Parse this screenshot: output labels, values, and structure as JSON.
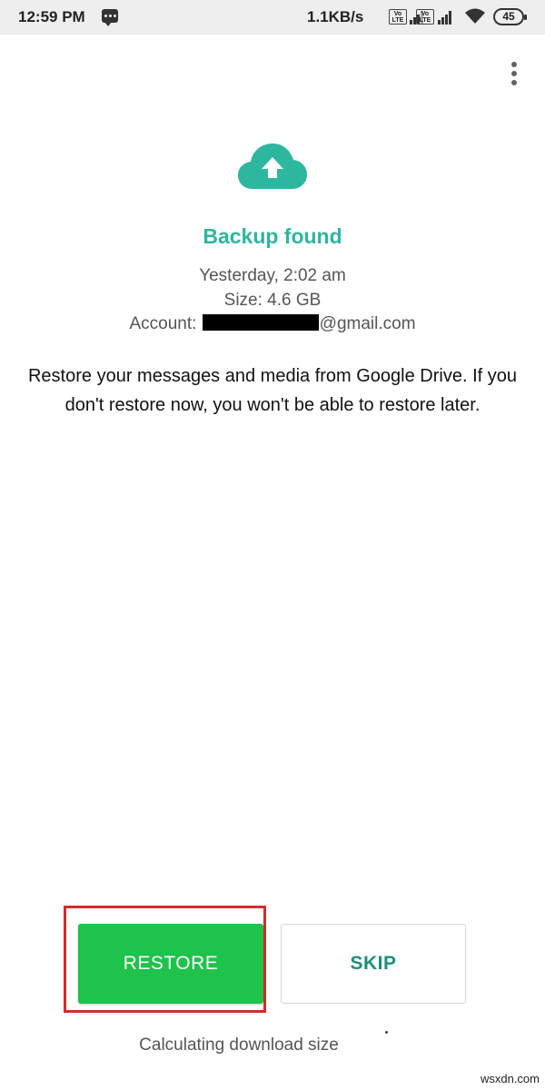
{
  "status_bar": {
    "time": "12:59 PM",
    "speed": "1.1KB/s",
    "volte_label": "Vo LTE",
    "battery": "45",
    "icons": [
      "chat-notification-icon",
      "volte-icon",
      "signal-icon",
      "volte-icon",
      "signal-icon",
      "wifi-icon",
      "battery-icon"
    ]
  },
  "header": {
    "menu_icon": "more-vert-icon"
  },
  "backup": {
    "icon": "cloud-upload-icon",
    "accent_color": "#2db79f",
    "title": "Backup found",
    "date": "Yesterday, 2:02 am",
    "size": "Size: 4.6 GB",
    "account_label": "Account:",
    "account_domain": "@gmail.com"
  },
  "description": "Restore your messages and media from Google Drive. If you don't restore now, you won't be able to restore later.",
  "actions": {
    "restore_label": "RESTORE",
    "restore_color": "#1fc24a",
    "skip_label": "SKIP"
  },
  "progress": {
    "status_text": "Calculating download size"
  },
  "watermark": "wsxdn.com"
}
